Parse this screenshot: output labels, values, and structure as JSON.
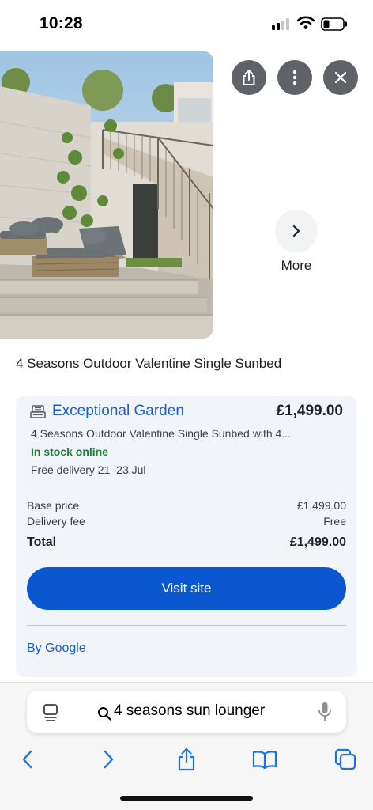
{
  "status_bar": {
    "time": "10:28"
  },
  "colors": {
    "accent": "#0b57d0",
    "link": "#1a5fc7",
    "in_stock": "#188038",
    "card_bg": "#f1f4f9"
  },
  "icons": {
    "share": "share-icon",
    "menu": "more-vert-icon",
    "close": "close-icon",
    "next": "chevron-right-icon",
    "seller": "store-icon",
    "tabs_overview": "tab-overview-icon",
    "search": "search-icon",
    "mic": "microphone-icon",
    "back": "chevron-left-icon",
    "forward": "chevron-right-icon",
    "bookmarks": "book-icon",
    "tabs": "tabs-icon"
  },
  "image_panel": {
    "more_label": "More"
  },
  "product": {
    "title": "4 Seasons Outdoor Valentine Single Sunbed"
  },
  "offer": {
    "seller": "Exceptional Garden",
    "price": "£1,499.00",
    "description": "4 Seasons Outdoor Valentine Single Sunbed with 4...",
    "stock": "In stock online",
    "delivery": "Free delivery 21–23 Jul",
    "base_price_label": "Base price",
    "base_price_value": "£1,499.00",
    "delivery_fee_label": "Delivery fee",
    "delivery_fee_value": "Free",
    "total_label": "Total",
    "total_value": "£1,499.00",
    "visit_label": "Visit site",
    "by_google": "By Google"
  },
  "browser": {
    "search_query": "4 seasons sun lounger"
  }
}
